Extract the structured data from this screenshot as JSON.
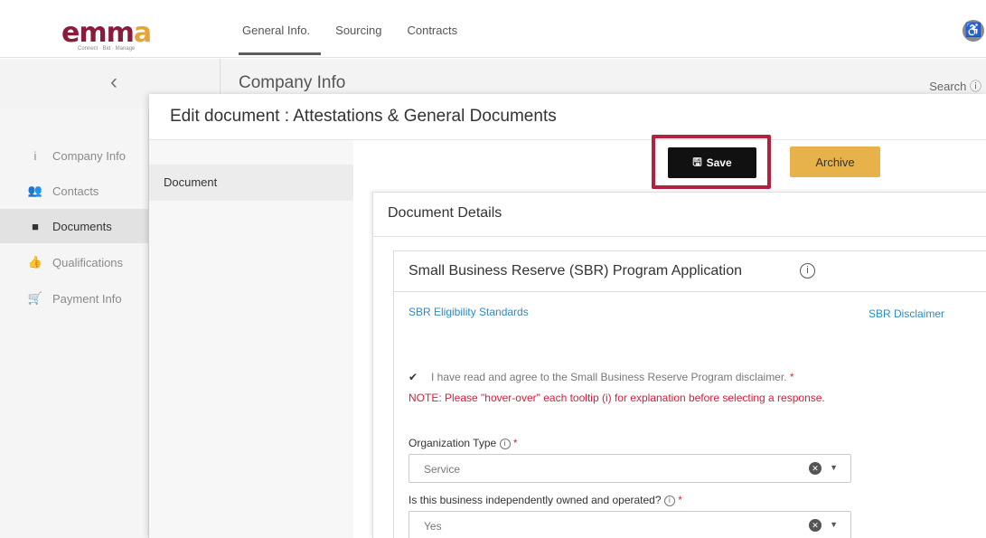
{
  "topbar": {
    "logo": {
      "part1": "e",
      "part2": "mm",
      "part3": "a",
      "tagline": "Connect · Bid · Manage"
    },
    "tabs": [
      {
        "label": "General Info."
      },
      {
        "label": "Sourcing"
      },
      {
        "label": "Contracts"
      }
    ],
    "active_tab": "General Info.",
    "accessibility_icon": "accessibility-icon"
  },
  "subheader": {
    "back_icon": "chevron-left-icon",
    "title": "Company Info",
    "search": "Search ⓘ"
  },
  "sidebar": {
    "items": [
      {
        "label": "Company Info",
        "icon": "info-icon",
        "glyph": "i"
      },
      {
        "label": "Contacts",
        "icon": "people-icon",
        "glyph": "👥"
      },
      {
        "label": "Documents",
        "icon": "book-icon",
        "glyph": "■"
      },
      {
        "label": "Qualifications",
        "icon": "thumbs-up-icon",
        "glyph": "👍"
      },
      {
        "label": "Payment Info",
        "icon": "cart-icon",
        "glyph": "🛒"
      }
    ],
    "active": "Documents"
  },
  "modal": {
    "title": "Edit document : Attestations & General Documents",
    "nav_item": "Document",
    "save_label": "Save",
    "archive_label": "Archive",
    "highlight_color": "#b3213f"
  },
  "details": {
    "title": "Document Details",
    "sbr": {
      "title": "Small Business Reserve (SBR) Program Application",
      "eligibility_link": "SBR Eligibility Standards",
      "disclaimer_link": "SBR Disclaimer",
      "checkbox_checked": true,
      "checkbox_label": "I have read and agree to the Small Business Reserve Program disclaimer.",
      "required_mark": "*",
      "note": "NOTE: Please \"hover-over\" each tooltip (i) for explanation before selecting a response.",
      "org_type_label": "Organization Type",
      "org_type_value": "Service",
      "independent_label": "Is this business independently owned and operated?",
      "independent_value": "Yes"
    }
  }
}
